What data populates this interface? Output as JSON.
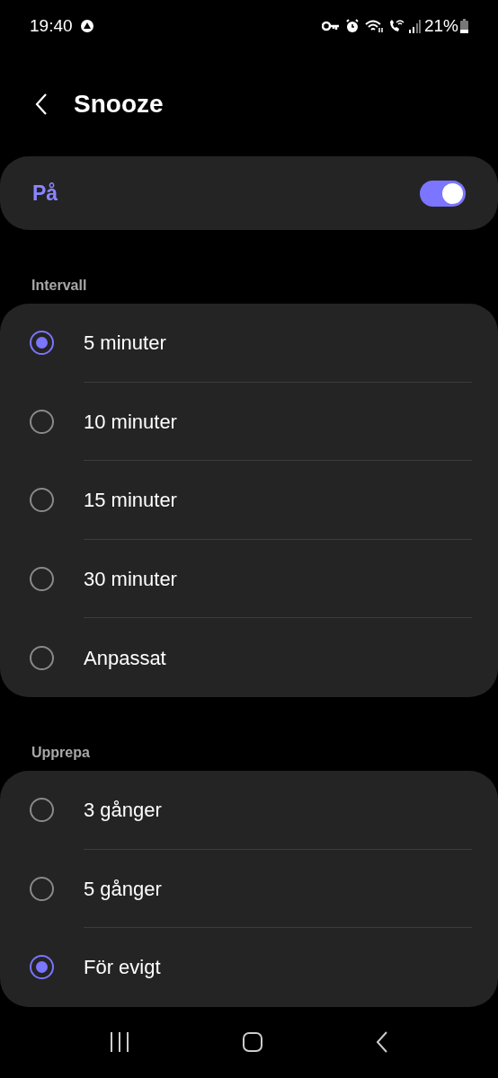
{
  "status_bar": {
    "time": "19:40",
    "battery": "21%"
  },
  "header": {
    "title": "Snooze"
  },
  "master": {
    "label": "På",
    "on": true
  },
  "sections": [
    {
      "title": "Intervall",
      "options": [
        {
          "label": "5 minuter",
          "selected": true
        },
        {
          "label": "10 minuter",
          "selected": false
        },
        {
          "label": "15 minuter",
          "selected": false
        },
        {
          "label": "30 minuter",
          "selected": false
        },
        {
          "label": "Anpassat",
          "selected": false
        }
      ]
    },
    {
      "title": "Upprepa",
      "options": [
        {
          "label": "3 gånger",
          "selected": false
        },
        {
          "label": "5 gånger",
          "selected": false
        },
        {
          "label": "För evigt",
          "selected": true
        }
      ]
    }
  ]
}
